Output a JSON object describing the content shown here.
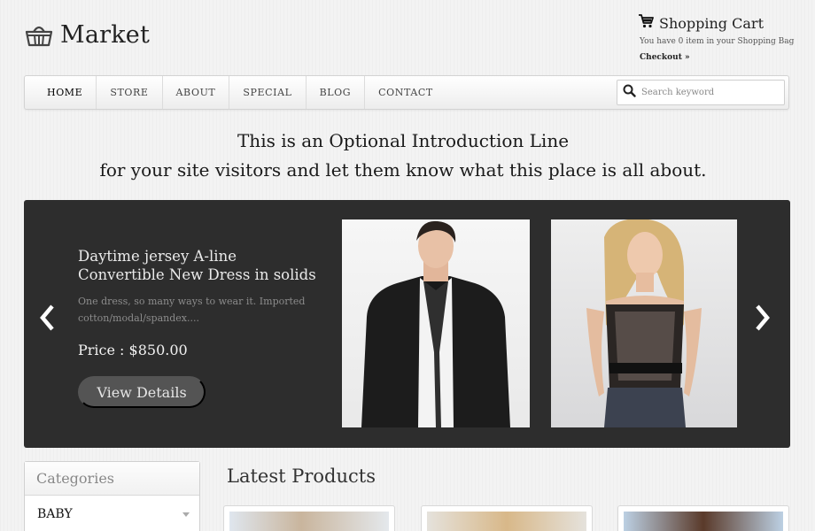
{
  "header": {
    "logo_text": "Market",
    "cart": {
      "title": "Shopping Cart",
      "subtitle": "You have 0 item in your Shopping Bag",
      "checkout": "Checkout »"
    }
  },
  "nav": {
    "items": [
      "HOME",
      "STORE",
      "ABOUT",
      "SPECIAL",
      "BLOG",
      "CONTACT"
    ],
    "active": "HOME",
    "search_placeholder": "Search keyword"
  },
  "intro": {
    "line1": "This is an Optional Introduction Line",
    "line2": "for your site visitors and let them know what this place is all about."
  },
  "slider": {
    "title": "Daytime jersey A-line Convertible New Dress in solids",
    "description": "One dress, so many ways to wear it. Imported cotton/modal/spandex....",
    "price": "Price : $850.00",
    "button": "View Details"
  },
  "sidebar": {
    "title": "Categories",
    "items": [
      "BABY"
    ]
  },
  "latest": {
    "title": "Latest Products"
  },
  "colors": {
    "slider_bg": "#2d2d2d",
    "button_bg": "#545454",
    "page_bg": "#f3f3f3"
  }
}
